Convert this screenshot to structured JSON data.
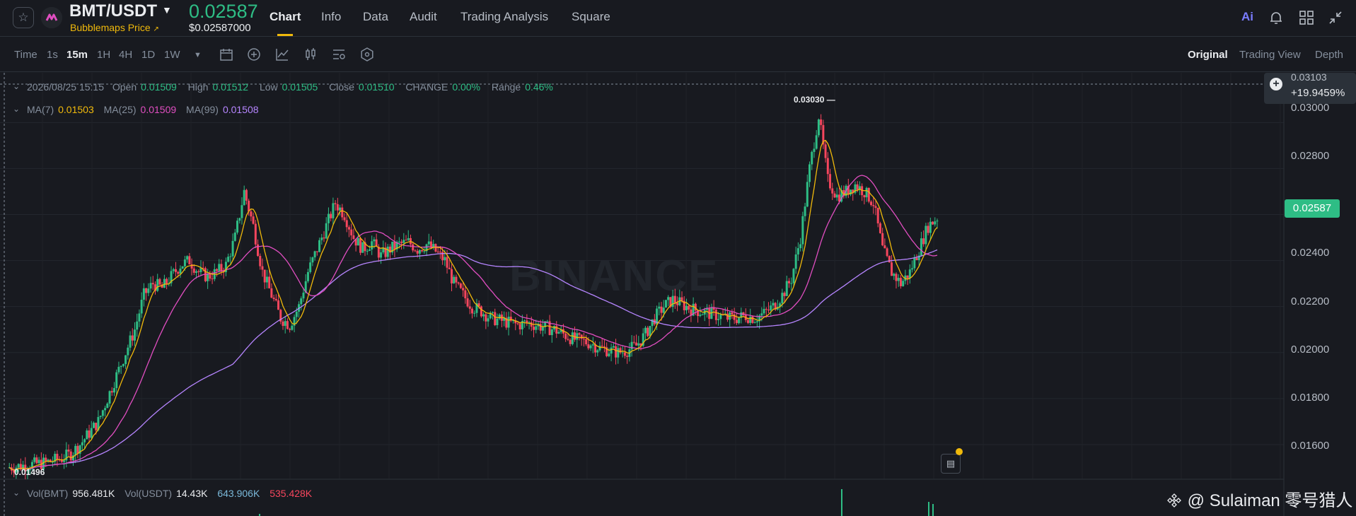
{
  "header": {
    "pair": "BMT/USDT",
    "subname": "Bubblemaps Price",
    "subname_arrow": "↗",
    "price": "0.02587",
    "usd_price": "$0.02587000",
    "nav": [
      "Chart",
      "Info",
      "Data",
      "Audit",
      "Trading Analysis",
      "Square"
    ],
    "ai_label": "Ai"
  },
  "toolbar": {
    "timeframes": [
      "Time",
      "1s",
      "15m",
      "1H",
      "4H",
      "1D",
      "1W"
    ],
    "active_timeframe": "15m",
    "views": [
      "Original",
      "Trading View",
      "Depth"
    ],
    "active_view": "Original"
  },
  "ohlc": {
    "date": "2026/08/25 15:15",
    "open_label": "Open",
    "open": "0.01509",
    "high_label": "High",
    "high": "0.01512",
    "low_label": "Low",
    "low": "0.01505",
    "close_label": "Close",
    "close": "0.01510",
    "change_label": "CHANGE",
    "change": "0.00%",
    "range_label": "Range",
    "range": "0.46%"
  },
  "ma": {
    "ma7_label": "MA(7)",
    "ma7": "0.01503",
    "ma25_label": "MA(25)",
    "ma25": "0.01509",
    "ma99_label": "MA(99)",
    "ma99": "0.01508"
  },
  "colors": {
    "up": "#2ebd85",
    "down": "#f6465d",
    "ma7": "#f0b90b",
    "ma25": "#e14ec1",
    "ma99": "#b685ff",
    "accent": "#f0b90b"
  },
  "crosshair": {
    "price": "0.03103",
    "change": "+19.9459%"
  },
  "y_axis": [
    "0.03000",
    "0.02800",
    "0.02400",
    "0.02200",
    "0.02000",
    "0.01800",
    "0.01600"
  ],
  "current_price_tag": "0.02587",
  "high_marker": "0.03030",
  "low_marker": "0.01496",
  "volume": {
    "vol_bmt_label": "Vol(BMT)",
    "vol_bmt": "956.481K",
    "vol_usdt_label": "Vol(USDT)",
    "vol_usdt": "14.43K",
    "v2": "643.906K",
    "v3": "535.428K"
  },
  "watermark": "BINANCE",
  "footer": "@ Sulaiman 零号猎人",
  "chart_data": {
    "type": "candlestick",
    "y_range": [
      0.0148,
      0.0317
    ],
    "close_series": [
      0.015,
      0.01505,
      0.0151,
      0.01515,
      0.0152,
      0.0153,
      0.0154,
      0.0156,
      0.016,
      0.0165,
      0.017,
      0.018,
      0.019,
      0.02,
      0.021,
      0.0225,
      0.023,
      0.0228,
      0.0233,
      0.0238,
      0.024,
      0.0235,
      0.0233,
      0.0235,
      0.0238,
      0.025,
      0.027,
      0.0255,
      0.0235,
      0.0225,
      0.0215,
      0.0212,
      0.022,
      0.0235,
      0.0245,
      0.0255,
      0.0265,
      0.026,
      0.025,
      0.0245,
      0.0248,
      0.0242,
      0.0245,
      0.0247,
      0.0248,
      0.0245,
      0.0247,
      0.0244,
      0.024,
      0.023,
      0.0225,
      0.022,
      0.0218,
      0.0215,
      0.0214,
      0.0213,
      0.0212,
      0.0213,
      0.0212,
      0.0211,
      0.021,
      0.0208,
      0.0206,
      0.0205,
      0.0204,
      0.0202,
      0.0201,
      0.02,
      0.0201,
      0.0203,
      0.0208,
      0.0215,
      0.022,
      0.0223,
      0.0221,
      0.0219,
      0.0218,
      0.0217,
      0.0216,
      0.0215,
      0.0215,
      0.0216,
      0.0215,
      0.0217,
      0.022,
      0.0225,
      0.0232,
      0.025,
      0.028,
      0.0303,
      0.0275,
      0.0268,
      0.027,
      0.0273,
      0.027,
      0.0265,
      0.0245,
      0.0235,
      0.023,
      0.0235,
      0.0245,
      0.0255,
      0.02587
    ]
  }
}
